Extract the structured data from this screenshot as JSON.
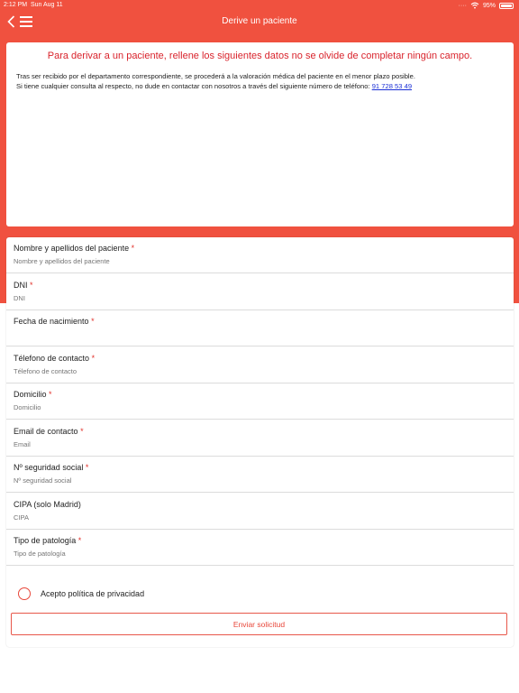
{
  "status_bar": {
    "time": "2:12 PM",
    "date": "Sun Aug 11",
    "battery": "95%",
    "dots": "····"
  },
  "nav": {
    "title": "Derive un paciente",
    "back_icon": "chevron-left-icon",
    "menu_icon": "hamburger-menu-icon"
  },
  "info": {
    "heading": "Para derivar a un paciente, rellene los siguientes datos no se olvide de completar ningún campo.",
    "line1": "Tras ser recibido por el departamento correspondiente, se procederá a la valoración médica del paciente en el menor plazo posible.",
    "line2": "Si tiene cualquier consulta al respecto, no dude en contactar con nosotros a través del siguiente número de teléfono: ",
    "phone": "91 728 53 49"
  },
  "form": {
    "fields": [
      {
        "label": "Nombre y apellidos del paciente",
        "required": "*",
        "placeholder": "Nombre y apellidos del paciente"
      },
      {
        "label": "DNI",
        "required": "*",
        "placeholder": "DNI"
      },
      {
        "label": "Fecha de nacimiento",
        "required": "*",
        "placeholder": ""
      },
      {
        "label": "Télefono de contacto",
        "required": "*",
        "placeholder": "Télefono de contacto"
      },
      {
        "label": "Domicilio",
        "required": "*",
        "placeholder": "Domicilio"
      },
      {
        "label": "Email de contacto",
        "required": "*",
        "placeholder": "Email"
      },
      {
        "label": "Nº seguridad social",
        "required": "*",
        "placeholder": "Nº seguridad social"
      },
      {
        "label": "CIPA (solo Madrid)",
        "required": "",
        "placeholder": "CIPA"
      },
      {
        "label": "Tipo de patología",
        "required": "*",
        "placeholder": "Tipo de patología"
      }
    ],
    "privacy_label": "Acepto política de privacidad",
    "submit_label": "Enviar solicitud"
  },
  "colors": {
    "brand": "#f0513f",
    "accent_red": "#d9232c",
    "link": "#1a2fd6"
  }
}
